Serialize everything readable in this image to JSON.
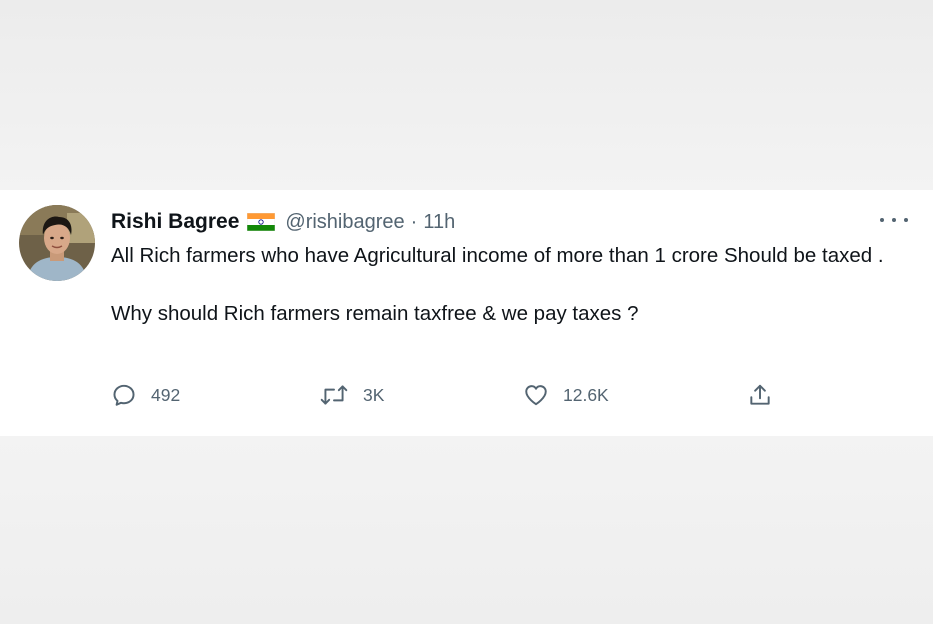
{
  "tweet": {
    "author": {
      "name": "Rishi Bagree",
      "handle": "@rishibagree",
      "flag_icon": "india-flag-icon"
    },
    "separator": "·",
    "time": "11h",
    "body": {
      "paragraph1": "All Rich farmers who have Agricultural income of more than 1 crore Should be taxed .",
      "paragraph2": "Why should Rich farmers remain taxfree & we pay taxes ?"
    },
    "actions": {
      "replies": "492",
      "retweets": "3K",
      "likes": "12.6K"
    }
  },
  "colors": {
    "text_primary": "#0f1419",
    "text_secondary": "#536471",
    "background": "#ffffff",
    "flag_saffron": "#ff9933",
    "flag_green": "#138808",
    "flag_chakra": "#000080"
  }
}
